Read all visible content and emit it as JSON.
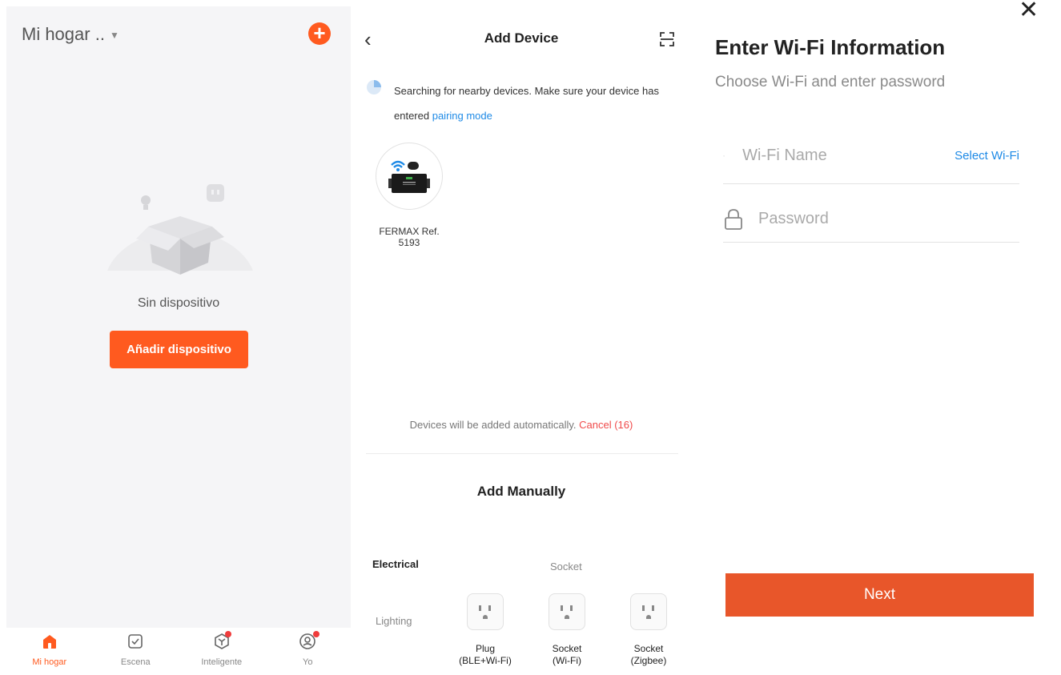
{
  "home": {
    "title": "Mi hogar ..",
    "empty_text": "Sin dispositivo",
    "add_button": "Añadir dispositivo",
    "tabs": [
      {
        "label": "Mi hogar",
        "icon": "home-icon",
        "active": true,
        "badge": false
      },
      {
        "label": "Escena",
        "icon": "check-square-icon",
        "active": false,
        "badge": false
      },
      {
        "label": "Inteligente",
        "icon": "smart-cube-icon",
        "active": false,
        "badge": true
      },
      {
        "label": "Yo",
        "icon": "profile-icon",
        "active": false,
        "badge": true
      }
    ]
  },
  "add_device": {
    "title": "Add Device",
    "search_text": "Searching for nearby devices. Make sure your device has entered",
    "pairing_link": "pairing mode",
    "found_device": {
      "name": "FERMAX Ref. 5193"
    },
    "auto_text": "Devices will be added automatically.",
    "cancel_text": "Cancel (16)",
    "manual_title": "Add Manually",
    "categories": [
      "Electrical",
      "Lighting"
    ],
    "section_title": "Socket",
    "products": [
      {
        "label": "Plug\n(BLE+Wi-Fi)"
      },
      {
        "label": "Socket\n(Wi-Fi)"
      },
      {
        "label": "Socket\n(Zigbee)"
      }
    ]
  },
  "wifi": {
    "title": "Enter Wi-Fi Information",
    "subtitle": "Choose Wi-Fi and enter password",
    "wifi_placeholder": "Wi-Fi Name",
    "select_wifi": "Select Wi-Fi",
    "password_placeholder": "Password",
    "next_label": "Next"
  },
  "colors": {
    "accent": "#ff5a1f",
    "link": "#1e8ae6",
    "cancel": "#f04a4a",
    "next": "#e8562a"
  }
}
